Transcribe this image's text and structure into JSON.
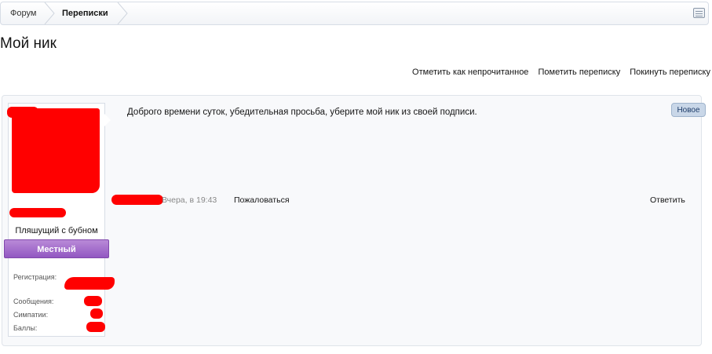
{
  "breadcrumb": {
    "items": [
      {
        "label": "Форум"
      },
      {
        "label": "Переписки"
      }
    ]
  },
  "page": {
    "title": "Мой ник"
  },
  "actions": {
    "mark_unread": "Отметить как непрочитанное",
    "mark_conversation": "Пометить переписку",
    "leave_conversation": "Покинуть переписку"
  },
  "message": {
    "text": "Доброго времени суток, убедительная просьба, уберите мой ник из своей подписи.",
    "badge": "Новое",
    "date": "Вчера, в 19:43",
    "report_label": "Пожаловаться",
    "reply_label": "Ответить"
  },
  "user": {
    "title": "Пляшущий с бубном",
    "banner": "Местный",
    "banner_color": "#9b62c8",
    "stats": {
      "registration_label": "Регистрация:",
      "messages_label": "Сообщения:",
      "likes_label": "Симпатии:",
      "points_label": "Баллы:"
    }
  },
  "colors": {
    "redaction": "#ff0000",
    "border": "#d7dde6"
  },
  "icons": {
    "jump": "jump-menu-icon"
  }
}
